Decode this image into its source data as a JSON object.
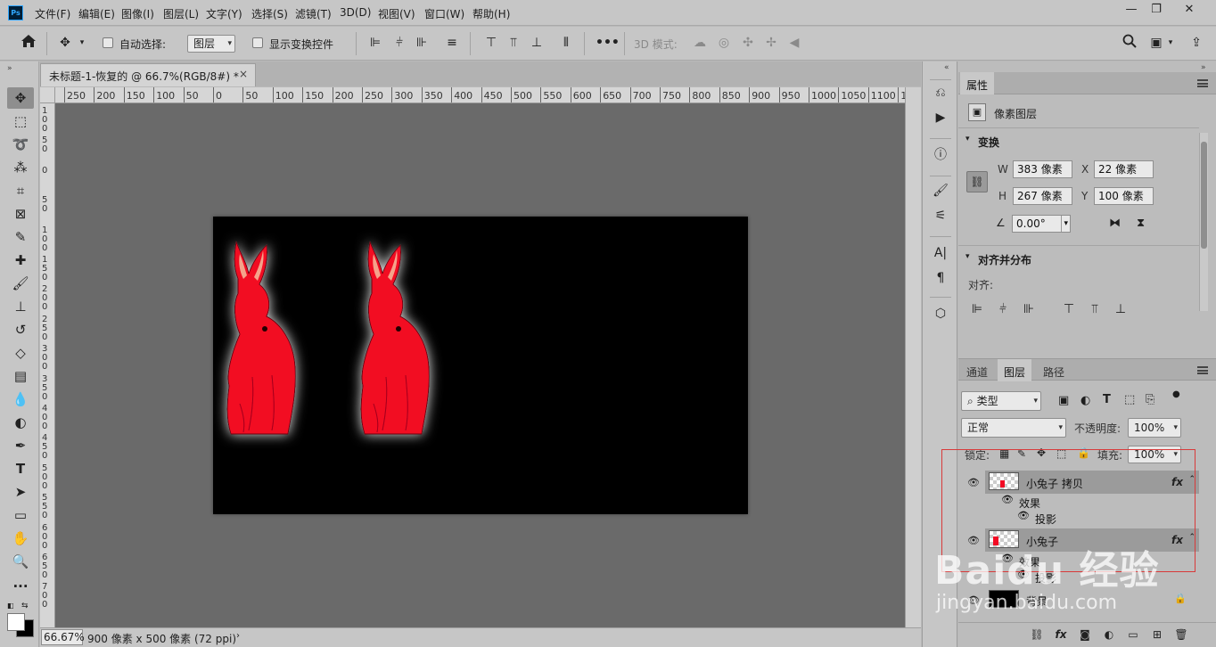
{
  "menubar": {
    "logo": "Ps",
    "items": [
      "文件(F)",
      "编辑(E)",
      "图像(I)",
      "图层(L)",
      "文字(Y)",
      "选择(S)",
      "滤镜(T)",
      "3D(D)",
      "视图(V)",
      "窗口(W)",
      "帮助(H)"
    ],
    "window_controls": [
      "—",
      "❐",
      "✕"
    ]
  },
  "options": {
    "auto_select_label": "自动选择:",
    "auto_select_value": "图层",
    "show_transform_label": "显示变换控件",
    "mode_3d_label": "3D 模式:"
  },
  "document": {
    "tab_title": "未标题-1-恢复的 @ 66.7%(RGB/8#) *",
    "zoom": "66.67%",
    "size_info": "900 像素 x 500 像素 (72 ppi)",
    "ruler_h": [
      "250",
      "200",
      "150",
      "100",
      "50",
      "0",
      "50",
      "100",
      "150",
      "200",
      "250",
      "300",
      "350",
      "400",
      "450",
      "500",
      "550",
      "600",
      "650",
      "700",
      "750",
      "800",
      "850",
      "900",
      "950",
      "1000",
      "1050",
      "1100",
      "1"
    ],
    "ruler_v": [
      "1\n0\n0",
      "5\n0",
      "0",
      "5\n0",
      "1\n0\n0",
      "1\n5\n0",
      "2\n0\n0",
      "2\n5\n0",
      "3\n0\n0",
      "3\n5\n0",
      "4\n0\n0",
      "4\n5\n0",
      "5\n0\n0",
      "5\n5\n0",
      "6\n0\n0",
      "6\n5\n0",
      "7\n0\n0"
    ]
  },
  "properties": {
    "tab": "属性",
    "layer_type": "像素图层",
    "transform_title": "变换",
    "w_label": "W",
    "w_value": "383 像素",
    "x_label": "X",
    "x_value": "22 像素",
    "h_label": "H",
    "h_value": "267 像素",
    "y_label": "Y",
    "y_value": "100 像素",
    "angle_value": "0.00°",
    "align_title": "对齐并分布",
    "align_label": "对齐:"
  },
  "layers_panel": {
    "tabs": [
      "通道",
      "图层",
      "路径"
    ],
    "active_tab": "图层",
    "filter_kind": "类型",
    "blend_mode": "正常",
    "opacity_label": "不透明度:",
    "opacity_value": "100%",
    "lock_label": "锁定:",
    "fill_label": "填充:",
    "fill_value": "100%",
    "layers": [
      {
        "name": "小兔子 拷贝",
        "effects_label": "效果",
        "effect_name": "投影",
        "fx": "fx"
      },
      {
        "name": "小兔子",
        "effects_label": "效果",
        "effect_name": "投影",
        "fx": "fx"
      },
      {
        "name": "背景"
      }
    ]
  },
  "watermark": {
    "logo_text": "Baidu 经验",
    "url": "jingyan.baidu.com"
  },
  "colors": {
    "rabbit": "#f20a24",
    "canvas": "#000000",
    "highlight_box": "#d83a3a"
  }
}
